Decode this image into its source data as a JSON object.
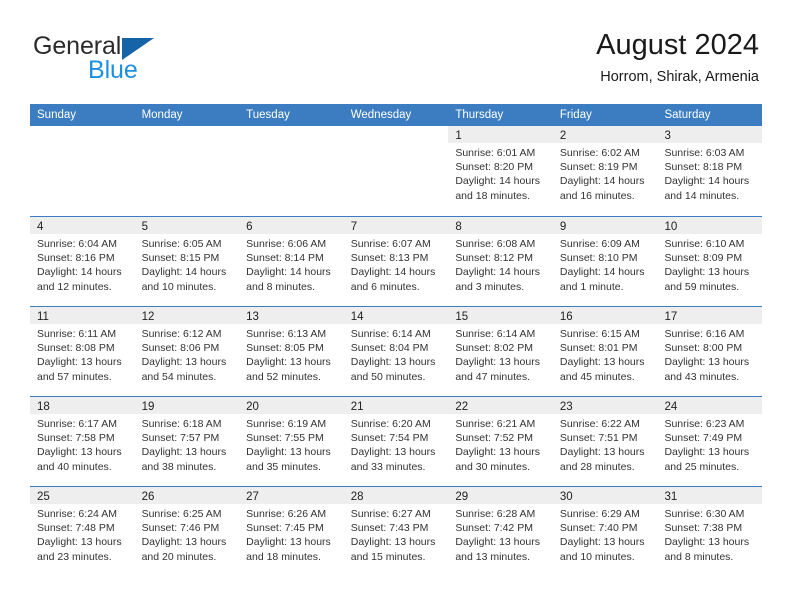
{
  "brand": {
    "name_part1": "General",
    "name_part2": "Blue",
    "flag_icon": "blue-triangle-flag-icon"
  },
  "header": {
    "title": "August 2024",
    "subtitle": "Horrom, Shirak, Armenia"
  },
  "colors": {
    "header_blue": "#3b7dc0",
    "brand_blue": "#1f8fe0",
    "flag_blue": "#1763a8",
    "numband_gray": "#eeeeee",
    "text_dark": "#222222"
  },
  "weekdays": [
    "Sunday",
    "Monday",
    "Tuesday",
    "Wednesday",
    "Thursday",
    "Friday",
    "Saturday"
  ],
  "labels": {
    "sunrise": "Sunrise:",
    "sunset": "Sunset:",
    "daylight": "Daylight:"
  },
  "weeks": [
    [
      {
        "day": "",
        "empty": true
      },
      {
        "day": "",
        "empty": true
      },
      {
        "day": "",
        "empty": true
      },
      {
        "day": "",
        "empty": true
      },
      {
        "day": "1",
        "sunrise": "Sunrise: 6:01 AM",
        "sunset": "Sunset: 8:20 PM",
        "daylight1": "Daylight: 14 hours",
        "daylight2": "and 18 minutes."
      },
      {
        "day": "2",
        "sunrise": "Sunrise: 6:02 AM",
        "sunset": "Sunset: 8:19 PM",
        "daylight1": "Daylight: 14 hours",
        "daylight2": "and 16 minutes."
      },
      {
        "day": "3",
        "sunrise": "Sunrise: 6:03 AM",
        "sunset": "Sunset: 8:18 PM",
        "daylight1": "Daylight: 14 hours",
        "daylight2": "and 14 minutes."
      }
    ],
    [
      {
        "day": "4",
        "sunrise": "Sunrise: 6:04 AM",
        "sunset": "Sunset: 8:16 PM",
        "daylight1": "Daylight: 14 hours",
        "daylight2": "and 12 minutes."
      },
      {
        "day": "5",
        "sunrise": "Sunrise: 6:05 AM",
        "sunset": "Sunset: 8:15 PM",
        "daylight1": "Daylight: 14 hours",
        "daylight2": "and 10 minutes."
      },
      {
        "day": "6",
        "sunrise": "Sunrise: 6:06 AM",
        "sunset": "Sunset: 8:14 PM",
        "daylight1": "Daylight: 14 hours",
        "daylight2": "and 8 minutes."
      },
      {
        "day": "7",
        "sunrise": "Sunrise: 6:07 AM",
        "sunset": "Sunset: 8:13 PM",
        "daylight1": "Daylight: 14 hours",
        "daylight2": "and 6 minutes."
      },
      {
        "day": "8",
        "sunrise": "Sunrise: 6:08 AM",
        "sunset": "Sunset: 8:12 PM",
        "daylight1": "Daylight: 14 hours",
        "daylight2": "and 3 minutes."
      },
      {
        "day": "9",
        "sunrise": "Sunrise: 6:09 AM",
        "sunset": "Sunset: 8:10 PM",
        "daylight1": "Daylight: 14 hours",
        "daylight2": "and 1 minute."
      },
      {
        "day": "10",
        "sunrise": "Sunrise: 6:10 AM",
        "sunset": "Sunset: 8:09 PM",
        "daylight1": "Daylight: 13 hours",
        "daylight2": "and 59 minutes."
      }
    ],
    [
      {
        "day": "11",
        "sunrise": "Sunrise: 6:11 AM",
        "sunset": "Sunset: 8:08 PM",
        "daylight1": "Daylight: 13 hours",
        "daylight2": "and 57 minutes."
      },
      {
        "day": "12",
        "sunrise": "Sunrise: 6:12 AM",
        "sunset": "Sunset: 8:06 PM",
        "daylight1": "Daylight: 13 hours",
        "daylight2": "and 54 minutes."
      },
      {
        "day": "13",
        "sunrise": "Sunrise: 6:13 AM",
        "sunset": "Sunset: 8:05 PM",
        "daylight1": "Daylight: 13 hours",
        "daylight2": "and 52 minutes."
      },
      {
        "day": "14",
        "sunrise": "Sunrise: 6:14 AM",
        "sunset": "Sunset: 8:04 PM",
        "daylight1": "Daylight: 13 hours",
        "daylight2": "and 50 minutes."
      },
      {
        "day": "15",
        "sunrise": "Sunrise: 6:14 AM",
        "sunset": "Sunset: 8:02 PM",
        "daylight1": "Daylight: 13 hours",
        "daylight2": "and 47 minutes."
      },
      {
        "day": "16",
        "sunrise": "Sunrise: 6:15 AM",
        "sunset": "Sunset: 8:01 PM",
        "daylight1": "Daylight: 13 hours",
        "daylight2": "and 45 minutes."
      },
      {
        "day": "17",
        "sunrise": "Sunrise: 6:16 AM",
        "sunset": "Sunset: 8:00 PM",
        "daylight1": "Daylight: 13 hours",
        "daylight2": "and 43 minutes."
      }
    ],
    [
      {
        "day": "18",
        "sunrise": "Sunrise: 6:17 AM",
        "sunset": "Sunset: 7:58 PM",
        "daylight1": "Daylight: 13 hours",
        "daylight2": "and 40 minutes."
      },
      {
        "day": "19",
        "sunrise": "Sunrise: 6:18 AM",
        "sunset": "Sunset: 7:57 PM",
        "daylight1": "Daylight: 13 hours",
        "daylight2": "and 38 minutes."
      },
      {
        "day": "20",
        "sunrise": "Sunrise: 6:19 AM",
        "sunset": "Sunset: 7:55 PM",
        "daylight1": "Daylight: 13 hours",
        "daylight2": "and 35 minutes."
      },
      {
        "day": "21",
        "sunrise": "Sunrise: 6:20 AM",
        "sunset": "Sunset: 7:54 PM",
        "daylight1": "Daylight: 13 hours",
        "daylight2": "and 33 minutes."
      },
      {
        "day": "22",
        "sunrise": "Sunrise: 6:21 AM",
        "sunset": "Sunset: 7:52 PM",
        "daylight1": "Daylight: 13 hours",
        "daylight2": "and 30 minutes."
      },
      {
        "day": "23",
        "sunrise": "Sunrise: 6:22 AM",
        "sunset": "Sunset: 7:51 PM",
        "daylight1": "Daylight: 13 hours",
        "daylight2": "and 28 minutes."
      },
      {
        "day": "24",
        "sunrise": "Sunrise: 6:23 AM",
        "sunset": "Sunset: 7:49 PM",
        "daylight1": "Daylight: 13 hours",
        "daylight2": "and 25 minutes."
      }
    ],
    [
      {
        "day": "25",
        "sunrise": "Sunrise: 6:24 AM",
        "sunset": "Sunset: 7:48 PM",
        "daylight1": "Daylight: 13 hours",
        "daylight2": "and 23 minutes."
      },
      {
        "day": "26",
        "sunrise": "Sunrise: 6:25 AM",
        "sunset": "Sunset: 7:46 PM",
        "daylight1": "Daylight: 13 hours",
        "daylight2": "and 20 minutes."
      },
      {
        "day": "27",
        "sunrise": "Sunrise: 6:26 AM",
        "sunset": "Sunset: 7:45 PM",
        "daylight1": "Daylight: 13 hours",
        "daylight2": "and 18 minutes."
      },
      {
        "day": "28",
        "sunrise": "Sunrise: 6:27 AM",
        "sunset": "Sunset: 7:43 PM",
        "daylight1": "Daylight: 13 hours",
        "daylight2": "and 15 minutes."
      },
      {
        "day": "29",
        "sunrise": "Sunrise: 6:28 AM",
        "sunset": "Sunset: 7:42 PM",
        "daylight1": "Daylight: 13 hours",
        "daylight2": "and 13 minutes."
      },
      {
        "day": "30",
        "sunrise": "Sunrise: 6:29 AM",
        "sunset": "Sunset: 7:40 PM",
        "daylight1": "Daylight: 13 hours",
        "daylight2": "and 10 minutes."
      },
      {
        "day": "31",
        "sunrise": "Sunrise: 6:30 AM",
        "sunset": "Sunset: 7:38 PM",
        "daylight1": "Daylight: 13 hours",
        "daylight2": "and 8 minutes."
      }
    ]
  ]
}
